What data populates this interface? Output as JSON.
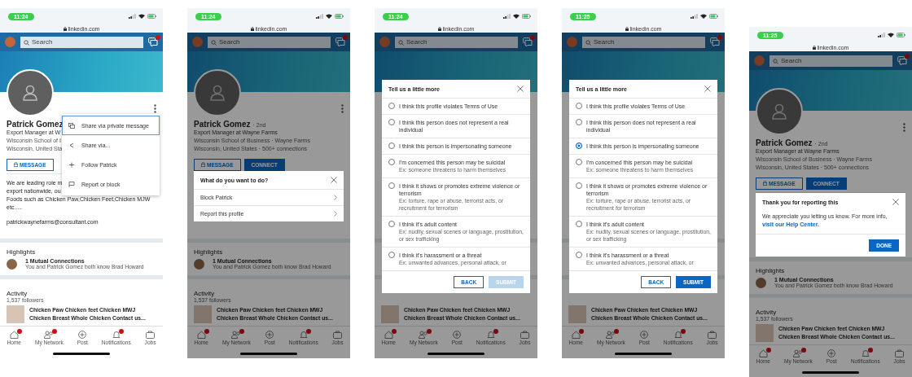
{
  "phones": [
    {
      "status": {
        "time": "11:24",
        "url": "linkedin.com"
      },
      "search": {
        "placeholder": "Search"
      },
      "messages_badge": true,
      "dimmed": false,
      "profile": {
        "name": "Patrick Gomez",
        "headline": "Export Manager at W",
        "school": "Wisconsin School of I",
        "location": "Wisconsin, United Sta",
        "buttons": [
          {
            "label": "MESSAGE",
            "kind": "outline"
          }
        ],
        "about": [
          "We are leading role m",
          "export nationwide, ou",
          "Foods such as Chicken Paw,Chicken Feet,Chicken MJW",
          "etc....."
        ],
        "email": "patrickwaynefarms@consultant.com",
        "highlights": {
          "title": "Highlights",
          "connections": "1 Mutual Connections",
          "connections_note": "You and Patrick Gomez both know Brad Howard"
        },
        "activity": {
          "title": "Activity",
          "followers": "1,537 followers",
          "post_lines": [
            "Chicken Paw Chicken feet Chicken MWJ",
            "Chicken Breast Whole Chicken Contact us..."
          ]
        }
      },
      "nav": [
        {
          "label": "Home",
          "kind": "home",
          "badge": true
        },
        {
          "label": "My Network",
          "kind": "network",
          "badge": true
        },
        {
          "label": "Post",
          "kind": "post",
          "badge": false
        },
        {
          "label": "Notifications",
          "kind": "bell",
          "badge": true
        },
        {
          "label": "Jobs",
          "kind": "jobs",
          "badge": false
        }
      ],
      "overlay": {
        "kind": "menu",
        "items": [
          {
            "label": "Share via private message",
            "kind": "message",
            "selected": true
          },
          {
            "label": "Share via...",
            "kind": "share",
            "selected": false
          },
          {
            "label": "Follow Patrick",
            "kind": "follow",
            "selected": false
          },
          {
            "label": "Report or block",
            "kind": "flag",
            "selected": false
          }
        ]
      }
    },
    {
      "status": {
        "time": "11:24",
        "url": "linkedin.com"
      },
      "search": {
        "placeholder": "Search"
      },
      "messages_badge": true,
      "dimmed": true,
      "profile": {
        "name": "Patrick Gomez",
        "degree": "· 2nd",
        "headline": "Export Manager at Wayne Farms",
        "school": "Wisconsin School of Business · Wayne Farms",
        "location": "Wisconsin, United States · 500+ connections",
        "buttons": [
          {
            "label": "MESSAGE",
            "kind": "outline"
          },
          {
            "label": "CONNECT",
            "kind": "primary"
          }
        ],
        "highlights": {
          "title": "Highlights",
          "connections": "1 Mutual Connections",
          "connections_note": "You and Patrick Gomez both know Brad Howard"
        },
        "activity": {
          "title": "Activity",
          "followers": "1,537 followers",
          "post_lines": [
            "Chicken Paw Chicken feet Chicken MWJ",
            "Chicken Breast Whole Chicken Contact us..."
          ]
        }
      },
      "nav": [
        {
          "label": "Home",
          "kind": "home",
          "badge": true
        },
        {
          "label": "My Network",
          "kind": "network",
          "badge": true
        },
        {
          "label": "Post",
          "kind": "post",
          "badge": false
        },
        {
          "label": "Notifications",
          "kind": "bell",
          "badge": true
        },
        {
          "label": "Jobs",
          "kind": "jobs",
          "badge": false
        }
      ],
      "overlay": {
        "kind": "choice",
        "title": "What do you want to do?",
        "items": [
          "Block Patrick",
          "Report this profile"
        ]
      }
    },
    {
      "status": {
        "time": "11:24",
        "url": "linkedin.com"
      },
      "search": {
        "placeholder": "Search"
      },
      "messages_badge": true,
      "dimmed": true,
      "profile": {
        "activity": {
          "post_lines": [
            "Chicken Paw Chicken feet Chicken MWJ",
            "Chicken Breast Whole Chicken Contact us..."
          ]
        }
      },
      "nav": [
        {
          "label": "Home",
          "kind": "home",
          "badge": true
        },
        {
          "label": "My Network",
          "kind": "network",
          "badge": true
        },
        {
          "label": "Post",
          "kind": "post",
          "badge": false
        },
        {
          "label": "Notifications",
          "kind": "bell",
          "badge": true
        },
        {
          "label": "Jobs",
          "kind": "jobs",
          "badge": false
        }
      ],
      "overlay": {
        "kind": "report",
        "title": "Tell us a little more",
        "options": [
          {
            "label": "I think this profile violates Terms of Use",
            "selected": false
          },
          {
            "label": "I think this person does not represent a real individual",
            "selected": false
          },
          {
            "label": "I think this person is impersonating someone",
            "selected": false
          },
          {
            "label": "I'm concerned this person may be suicidal",
            "example": "Ex: someone threatens to harm themselves",
            "selected": false
          },
          {
            "label": "I think it shows or promotes extreme violence or terrorism",
            "example": "Ex: torture, rape or abuse, terrorist acts, or recruitment for terrorism",
            "selected": false
          },
          {
            "label": "I think it's adult content",
            "example": "Ex: nudity, sexual scenes or language, prostitution, or sex trafficking",
            "selected": false
          },
          {
            "label": "I think it's harassment or a threat",
            "example": "Ex: unwanted advances, personal attack, or",
            "selected": false
          }
        ],
        "buttons": [
          {
            "label": "BACK",
            "kind": "outline",
            "disabled": false
          },
          {
            "label": "SUBMIT",
            "kind": "primary",
            "disabled": true
          }
        ]
      }
    },
    {
      "status": {
        "time": "11:25",
        "url": "linkedin.com"
      },
      "search": {
        "placeholder": "Search"
      },
      "messages_badge": true,
      "dimmed": true,
      "profile": {
        "activity": {
          "post_lines": [
            "Chicken Paw Chicken feet Chicken MWJ",
            "Chicken Breast Whole Chicken Contact us..."
          ]
        }
      },
      "nav": [
        {
          "label": "Home",
          "kind": "home",
          "badge": true
        },
        {
          "label": "My Network",
          "kind": "network",
          "badge": true
        },
        {
          "label": "Post",
          "kind": "post",
          "badge": false
        },
        {
          "label": "Notifications",
          "kind": "bell",
          "badge": true
        },
        {
          "label": "Jobs",
          "kind": "jobs",
          "badge": false
        }
      ],
      "overlay": {
        "kind": "report",
        "title": "Tell us a little more",
        "options": [
          {
            "label": "I think this profile violates Terms of Use",
            "selected": false
          },
          {
            "label": "I think this person does not represent a real individual",
            "selected": false
          },
          {
            "label": "I think this person is impersonating someone",
            "selected": true
          },
          {
            "label": "I'm concerned this person may be suicidal",
            "example": "Ex: someone threatens to harm themselves",
            "selected": false
          },
          {
            "label": "I think it shows or promotes extreme violence or terrorism",
            "example": "Ex: torture, rape or abuse, terrorist acts, or recruitment for terrorism",
            "selected": false
          },
          {
            "label": "I think it's adult content",
            "example": "Ex: nudity, sexual scenes or language, prostitution, or sex trafficking",
            "selected": false
          },
          {
            "label": "I think it's harassment or a threat",
            "example": "Ex: unwanted advances, personal attack, or",
            "selected": false
          }
        ],
        "buttons": [
          {
            "label": "BACK",
            "kind": "outline",
            "disabled": false
          },
          {
            "label": "SUBMIT",
            "kind": "primary",
            "disabled": false
          }
        ]
      }
    },
    {
      "status": {
        "time": "11:25",
        "url": "linkedin.com"
      },
      "search": {
        "placeholder": "Search"
      },
      "messages_badge": true,
      "dimmed": true,
      "profile": {
        "name": "Patrick Gomez",
        "degree": "· 2nd",
        "headline": "Export Manager at Wayne Farms",
        "school": "Wisconsin School of Business · Wayne Farms",
        "location": "Wisconsin, United States · 500+ connections",
        "buttons": [
          {
            "label": "MESSAGE",
            "kind": "outline"
          },
          {
            "label": "CONNECT",
            "kind": "primary"
          }
        ],
        "highlights": {
          "title": "Highlights",
          "connections": "1 Mutual Connections",
          "connections_note": "You and Patrick Gomez both know Brad Howard"
        },
        "activity": {
          "title": "Activity",
          "followers": "1,537 followers",
          "post_lines": [
            "Chicken Paw Chicken feet Chicken MWJ",
            "Chicken Breast Whole Chicken Contact us..."
          ]
        }
      },
      "nav": [
        {
          "label": "Home",
          "kind": "home",
          "badge": true
        },
        {
          "label": "My Network",
          "kind": "network",
          "badge": true
        },
        {
          "label": "Post",
          "kind": "post",
          "badge": false
        },
        {
          "label": "Notifications",
          "kind": "bell",
          "badge": true
        },
        {
          "label": "Jobs",
          "kind": "jobs",
          "badge": false
        }
      ],
      "overlay": {
        "kind": "thanks",
        "title": "Thank you for reporting this",
        "message": "We appreciate you letting us know. For more info,",
        "link": "visit our Help Center.",
        "button": "DONE"
      }
    }
  ]
}
